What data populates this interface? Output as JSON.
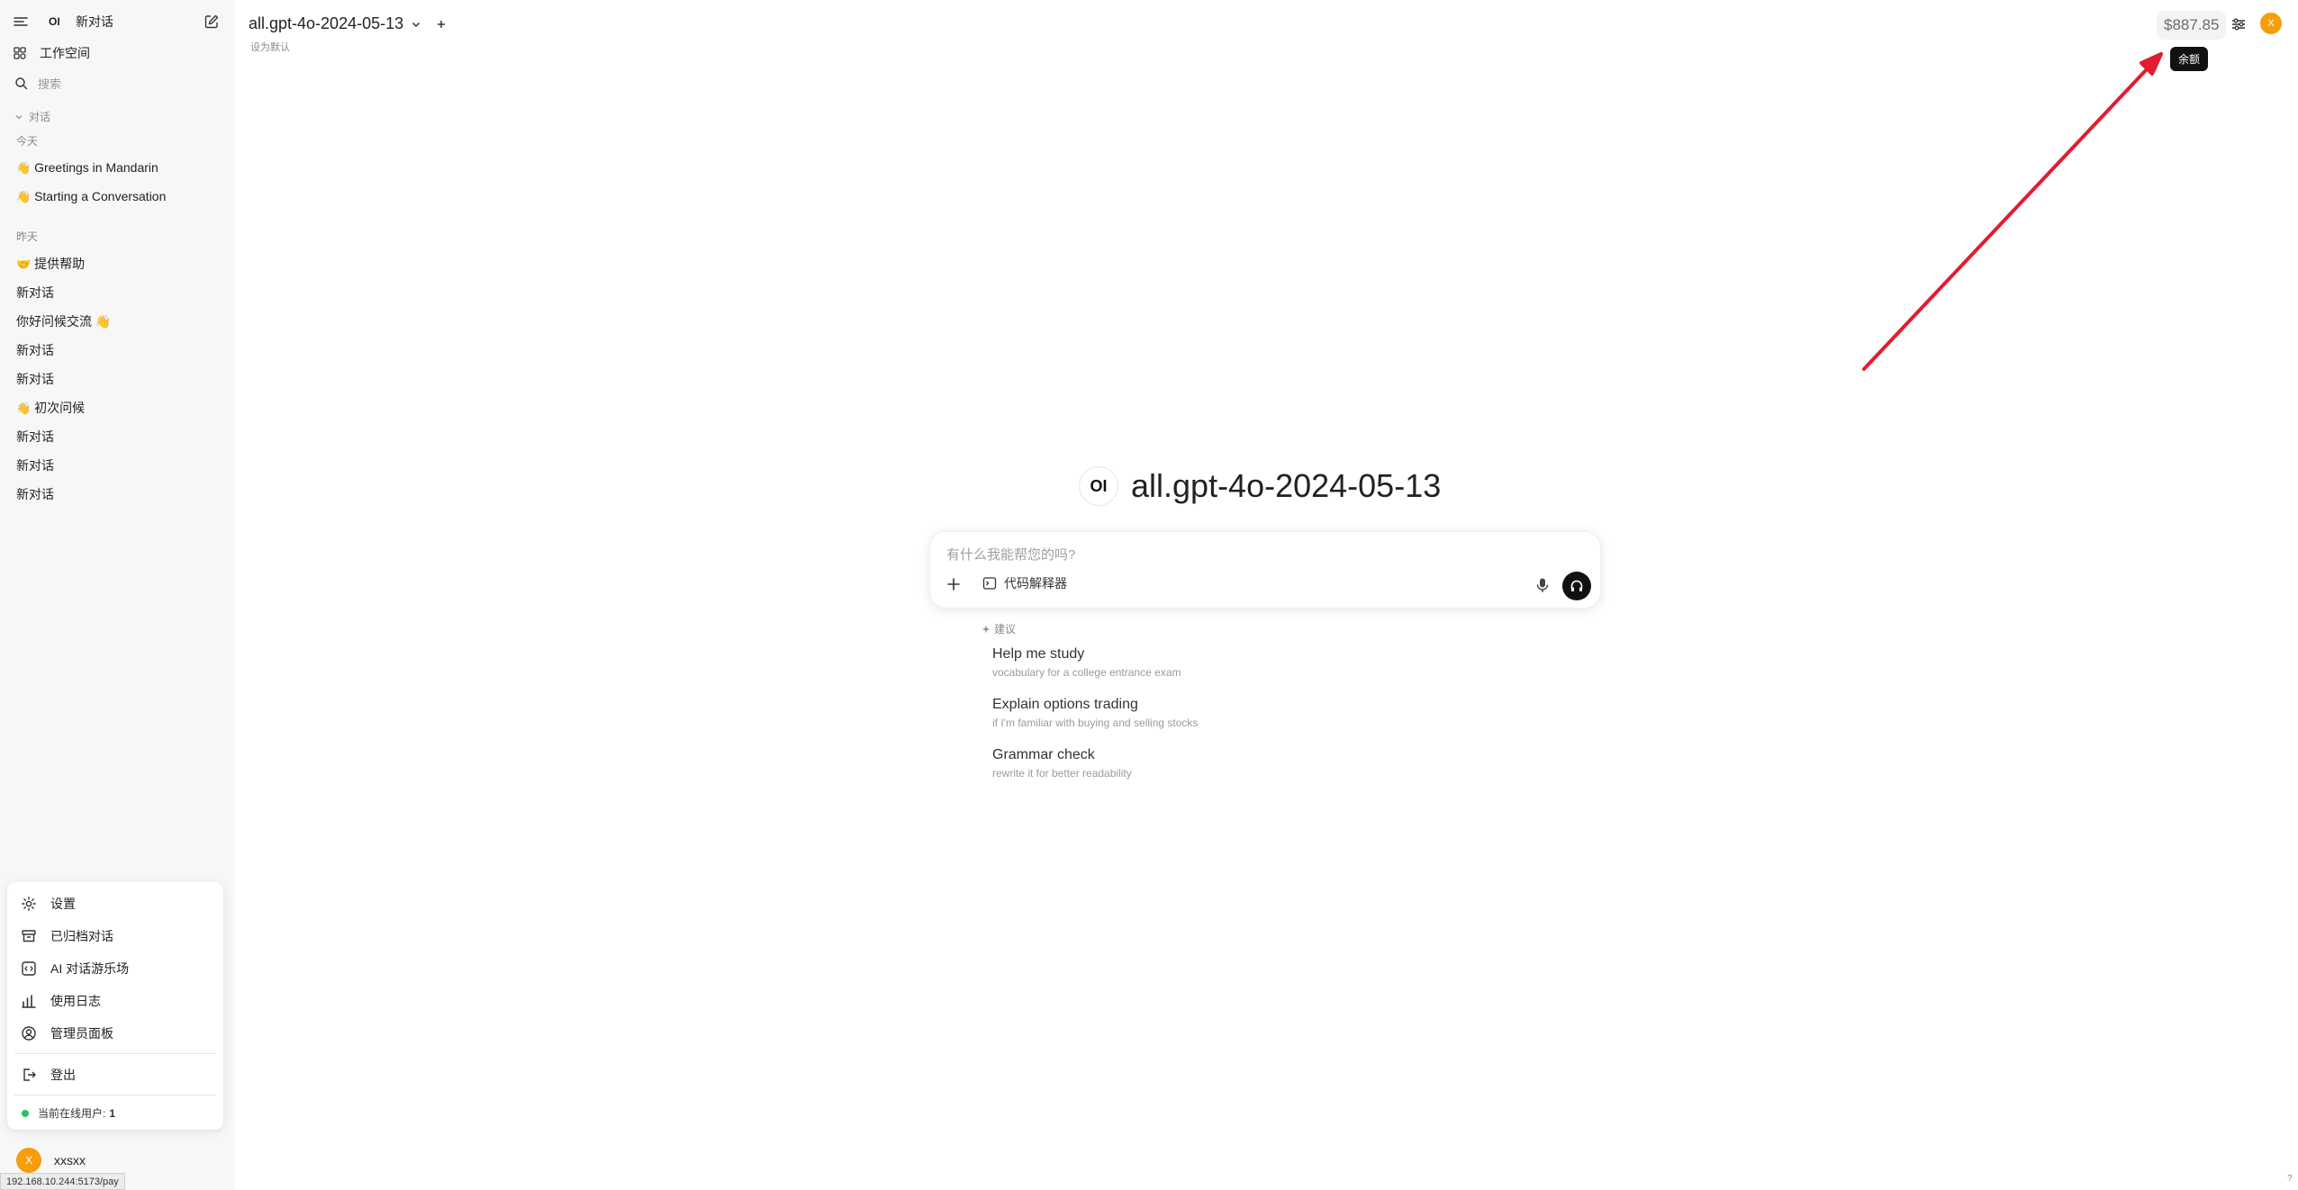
{
  "sidebar": {
    "brand_icon": "OI",
    "new_chat_label": "新对话",
    "workspace_label": "工作空间",
    "search_placeholder": "搜索",
    "section_label": "对话",
    "groups": [
      {
        "label": "今天",
        "items": [
          {
            "emoji": "👋",
            "title": "Greetings in Mandarin"
          },
          {
            "emoji": "👋",
            "title": "Starting a Conversation"
          }
        ]
      },
      {
        "label": "昨天",
        "items": [
          {
            "emoji": "🤝",
            "title": "提供帮助"
          },
          {
            "title": "新对话"
          },
          {
            "title": "你好问候交流 👋"
          },
          {
            "title": "新对话"
          },
          {
            "title": "新对话"
          },
          {
            "emoji": "👋",
            "title": "初次问候"
          },
          {
            "title": "新对话"
          },
          {
            "title": "新对话"
          },
          {
            "title": "新对话"
          }
        ]
      }
    ]
  },
  "menu": {
    "items": [
      {
        "icon": "gear-icon",
        "label": "设置"
      },
      {
        "icon": "archive-icon",
        "label": "已归档对话"
      },
      {
        "icon": "code-square-icon",
        "label": "AI 对话游乐场"
      },
      {
        "icon": "bar-chart-icon",
        "label": "使用日志"
      },
      {
        "icon": "user-circle-icon",
        "label": "管理员面板"
      },
      {
        "icon": "logout-icon",
        "label": "登出"
      }
    ],
    "online_label": "当前在线用户:",
    "online_count": "1"
  },
  "user": {
    "avatar_letter": "X",
    "name": "xxsxx"
  },
  "status_bar_url": "192.168.10.244:5173/pay",
  "header": {
    "model_name": "all.gpt-4o-2024-05-13",
    "set_default": "设为默认",
    "balance": "$887.85",
    "balance_tooltip": "余额",
    "avatar_letter": "X"
  },
  "main": {
    "logo": "OI",
    "model_title": "all.gpt-4o-2024-05-13",
    "input_placeholder": "有什么我能帮您的吗?",
    "tool_label": "代码解释器",
    "suggestions_label": "建议",
    "suggestions": [
      {
        "title": "Help me study",
        "subtitle": "vocabulary for a college entrance exam"
      },
      {
        "title": "Explain options trading",
        "subtitle": "if I'm familiar with buying and selling stocks"
      },
      {
        "title": "Grammar check",
        "subtitle": "rewrite it for better readability"
      }
    ]
  },
  "colors": {
    "accent_avatar": "#f59e0b",
    "annotation_arrow": "#e11d2e",
    "online_dot": "#22c55e"
  },
  "help_mark": "?"
}
